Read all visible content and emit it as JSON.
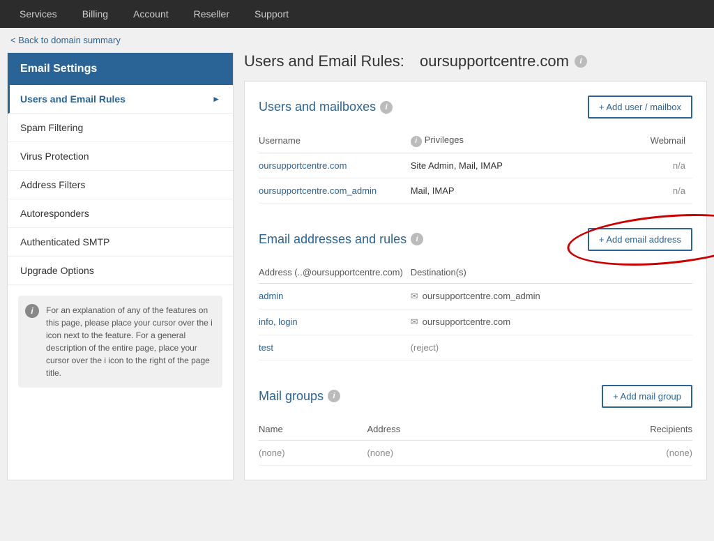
{
  "nav": {
    "items": [
      {
        "label": "Services",
        "active": true
      },
      {
        "label": "Billing"
      },
      {
        "label": "Account"
      },
      {
        "label": "Reseller"
      },
      {
        "label": "Support"
      }
    ]
  },
  "breadcrumb": {
    "link_text": "< Back to domain summary"
  },
  "sidebar": {
    "header": "Email Settings",
    "items": [
      {
        "label": "Users and Email Rules",
        "active": true
      },
      {
        "label": "Spam Filtering"
      },
      {
        "label": "Virus Protection"
      },
      {
        "label": "Address Filters"
      },
      {
        "label": "Autoresponders"
      },
      {
        "label": "Authenticated SMTP"
      },
      {
        "label": "Upgrade Options"
      }
    ],
    "info_text": "For an explanation of any of the features on this page, please place your cursor over the i icon next to the feature. For a general description of the entire page, place your cursor over the i icon to the right of the page title."
  },
  "page": {
    "title": "Users and Email Rules:",
    "domain": "oursupportcentre.com"
  },
  "users_section": {
    "title": "Users and mailboxes",
    "add_button": "+ Add user / mailbox",
    "columns": [
      "Username",
      "Privileges",
      "Webmail"
    ],
    "rows": [
      {
        "username": "oursupportcentre.com",
        "privileges": "Site Admin, Mail, IMAP",
        "webmail": "n/a"
      },
      {
        "username": "oursupportcentre.com_admin",
        "privileges": "Mail, IMAP",
        "webmail": "n/a"
      }
    ]
  },
  "email_rules_section": {
    "title": "Email addresses and rules",
    "add_button": "+ Add email address",
    "columns": [
      "Address (..@oursupportcentre.com)",
      "Destination(s)"
    ],
    "rows": [
      {
        "address": "admin",
        "destination": "oursupportcentre.com_admin",
        "has_envelope": true,
        "is_reject": false
      },
      {
        "address": "info, login",
        "destination": "oursupportcentre.com",
        "has_envelope": true,
        "is_reject": false
      },
      {
        "address": "test",
        "destination": "(reject)",
        "has_envelope": false,
        "is_reject": true
      }
    ]
  },
  "mail_groups_section": {
    "title": "Mail groups",
    "add_button": "+ Add mail group",
    "columns": [
      "Name",
      "Address",
      "Recipients"
    ],
    "rows": [
      {
        "name": "(none)",
        "address": "(none)",
        "recipients": "(none)"
      }
    ]
  }
}
